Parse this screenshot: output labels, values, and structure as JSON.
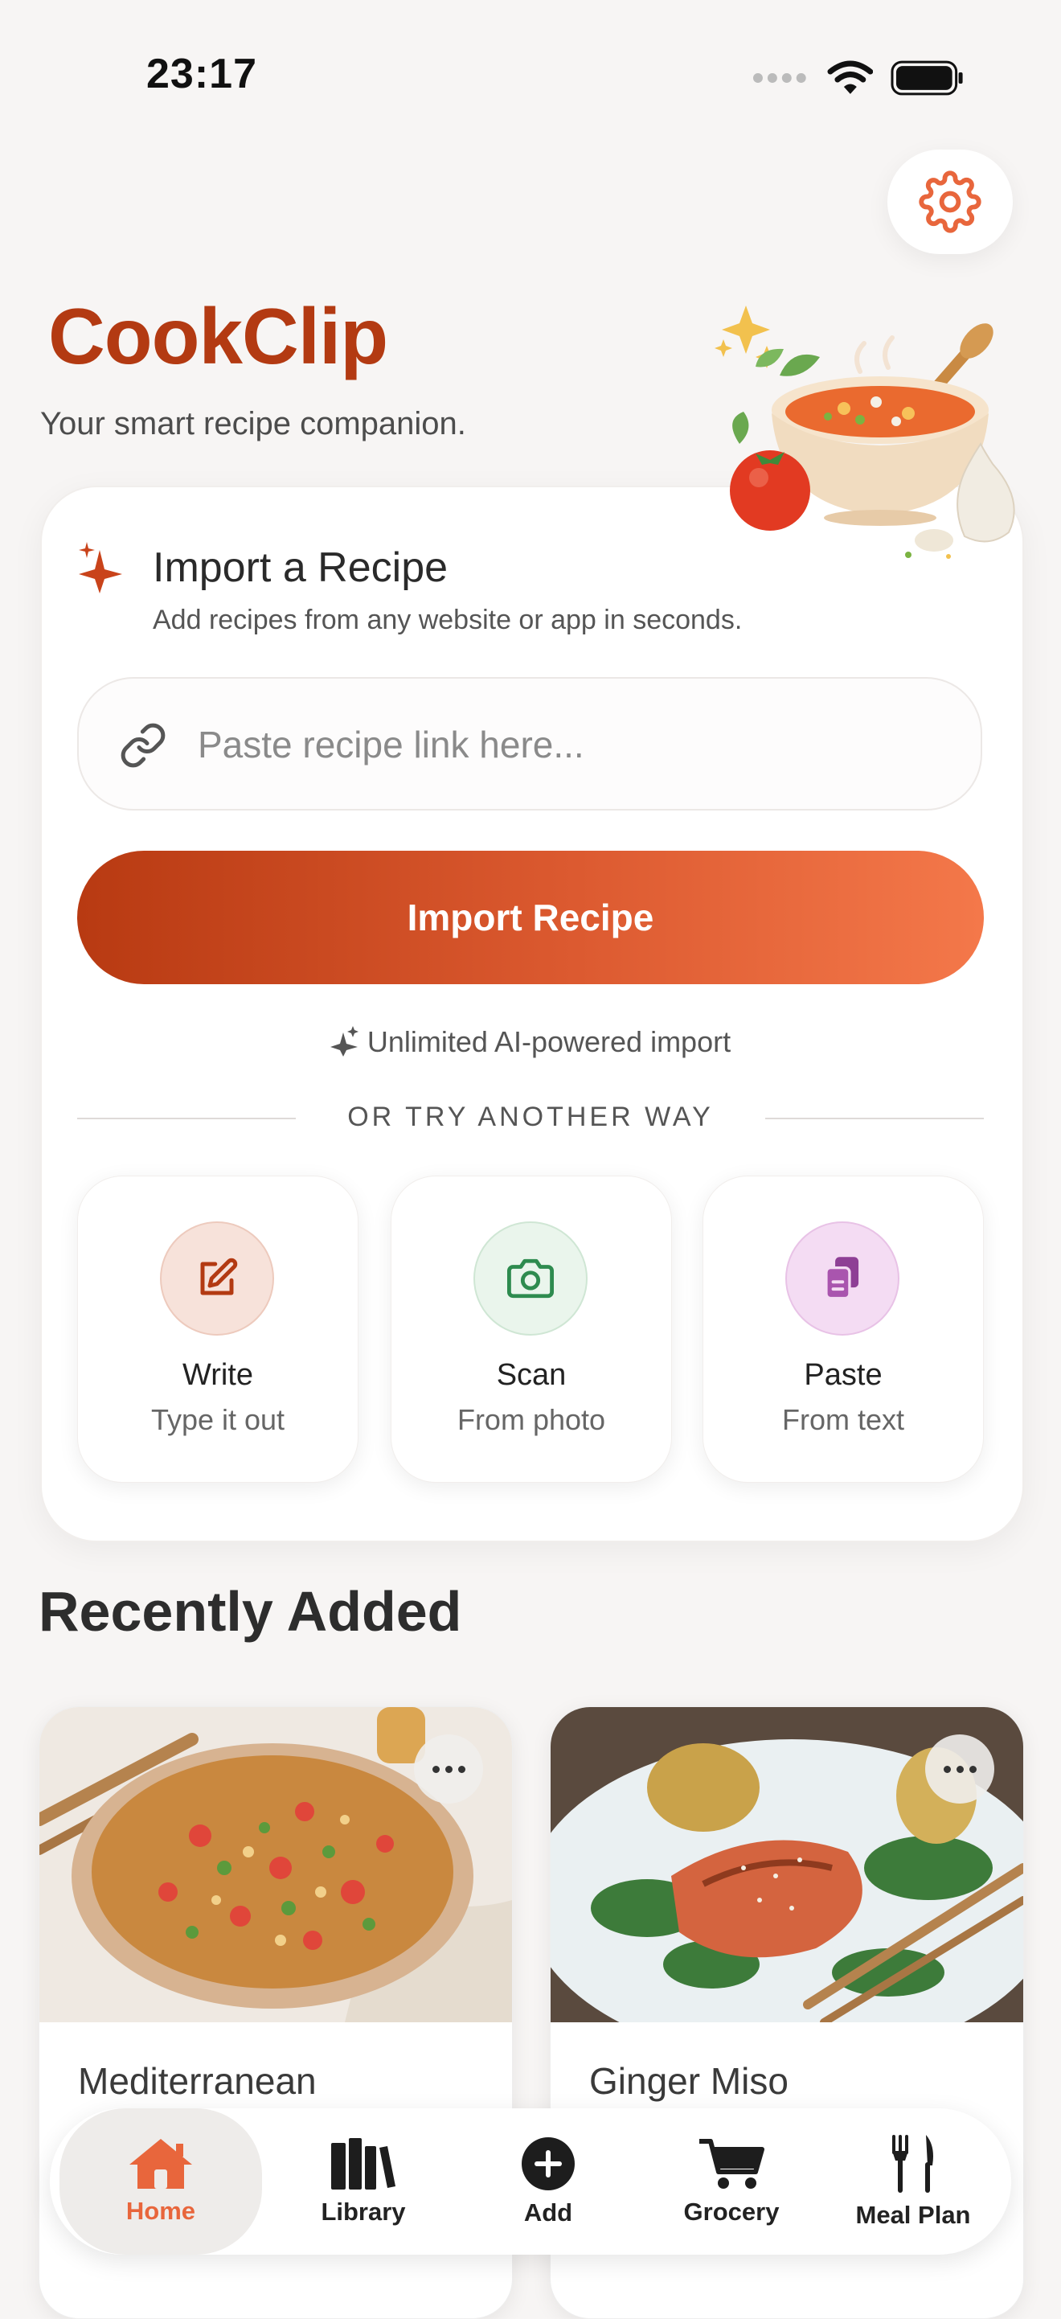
{
  "status": {
    "time": "23:17"
  },
  "header": {
    "brand": "CookClip",
    "tagline": "Your smart recipe companion."
  },
  "import": {
    "title": "Import a Recipe",
    "subtitle": "Add recipes from any website or app in seconds.",
    "link_placeholder": "Paste recipe link here...",
    "button_label": "Import Recipe",
    "ai_note": "Unlimited AI-powered import",
    "divider": "OR TRY ANOTHER WAY"
  },
  "options": [
    {
      "title": "Write",
      "subtitle": "Type it out"
    },
    {
      "title": "Scan",
      "subtitle": "From photo"
    },
    {
      "title": "Paste",
      "subtitle": "From text"
    }
  ],
  "recent": {
    "title": "Recently Added",
    "items": [
      {
        "title": "Mediterranean"
      },
      {
        "title": "Ginger Miso"
      }
    ]
  },
  "tabs": [
    {
      "label": "Home",
      "active": true
    },
    {
      "label": "Library"
    },
    {
      "label": "Add"
    },
    {
      "label": "Grocery"
    },
    {
      "label": "Meal Plan"
    }
  ],
  "colors": {
    "accent": "#b33a12",
    "accent_light": "#f4784a",
    "active_tab": "#e8663c"
  }
}
